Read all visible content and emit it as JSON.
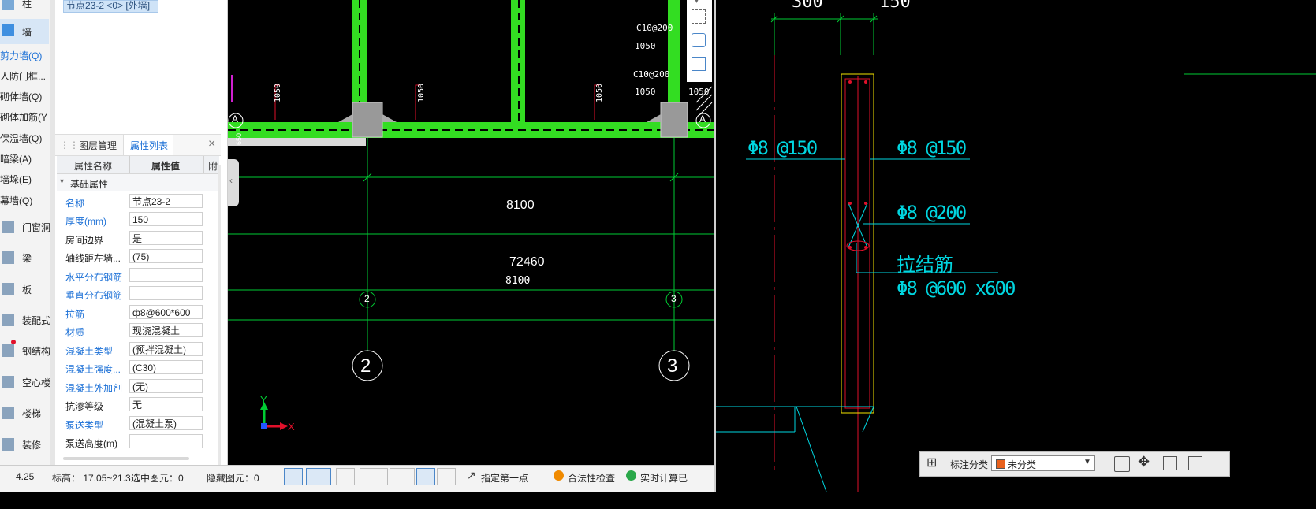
{
  "sidebar": {
    "items": [
      {
        "label": "柱",
        "icon": "column-icon"
      },
      {
        "label": "墙",
        "icon": "wall-icon"
      },
      {
        "label": "剪力墙(Q)"
      },
      {
        "label": "人防门框..."
      },
      {
        "label": "砌体墙(Q)"
      },
      {
        "label": "砌体加筋(Y"
      },
      {
        "label": "保温墙(Q)"
      },
      {
        "label": "暗梁(A)"
      },
      {
        "label": "墙垛(E)"
      },
      {
        "label": "幕墙(Q)"
      },
      {
        "label": "门窗洞",
        "icon": "door-window-icon"
      },
      {
        "label": "梁",
        "icon": "beam-icon"
      },
      {
        "label": "板",
        "icon": "slab-icon"
      },
      {
        "label": "装配式",
        "icon": "prefab-icon"
      },
      {
        "label": "钢结构",
        "icon": "steel-icon"
      },
      {
        "label": "空心楼盖",
        "icon": "hollow-floor-icon"
      },
      {
        "label": "楼梯",
        "icon": "stair-icon"
      },
      {
        "label": "装修",
        "icon": "decoration-icon"
      }
    ]
  },
  "tree": {
    "selected_item": "节点23-2 <0> [外墙]"
  },
  "panel": {
    "tabs": [
      {
        "label": "图层管理"
      },
      {
        "label": "属性列表"
      }
    ],
    "close_glyph": "×",
    "header": {
      "name_col": "属性名称",
      "value_col": "属性值",
      "extra_col": "附"
    },
    "group": "基础属性",
    "rows": [
      {
        "name": "名称",
        "value": "节点23-2",
        "style": "blue"
      },
      {
        "name": "厚度(mm)",
        "value": "150",
        "style": "blue"
      },
      {
        "name": "房间边界",
        "value": "是",
        "style": "black"
      },
      {
        "name": "轴线距左墙...",
        "value": "(75)",
        "style": "black"
      },
      {
        "name": "水平分布钢筋",
        "value": "",
        "style": "blue"
      },
      {
        "name": "垂直分布钢筋",
        "value": "",
        "style": "blue"
      },
      {
        "name": "拉筋",
        "value": "ф8@600*600",
        "style": "blue"
      },
      {
        "name": "材质",
        "value": "现浇混凝土",
        "style": "blue"
      },
      {
        "name": "混凝土类型",
        "value": "(预拌混凝土)",
        "style": "blue"
      },
      {
        "name": "混凝土强度...",
        "value": "(C30)",
        "style": "blue"
      },
      {
        "name": "混凝土外加剂",
        "value": "(无)",
        "style": "blue"
      },
      {
        "name": "抗渗等级",
        "value": "无",
        "style": "black"
      },
      {
        "name": "泵送类型",
        "value": "(混凝土泵)",
        "style": "blue"
      },
      {
        "name": "泵送高度(m)",
        "value": "",
        "style": "black"
      }
    ]
  },
  "cad_left": {
    "rebar_top1": "C10@200",
    "len_top1": "1050",
    "rebar_top2": "C10@200",
    "len_top2": "1050",
    "len_top3": "1050",
    "vert_labels": [
      "1050",
      "1050",
      "1050"
    ],
    "left_small": "650",
    "axis_a": "A",
    "dim_bay": "8100",
    "dim_total": "72460",
    "dim_bay2": "8100",
    "grid_small_2": "2",
    "grid_small_3": "3",
    "grid_big_2": "2",
    "grid_big_3": "3",
    "ucs_x": "X",
    "ucs_y": "Y"
  },
  "cad_right": {
    "dim_300": "300",
    "dim_150": "150",
    "rebar_left": "Φ8 @150",
    "rebar_right": "Φ8 @150",
    "rebar_mid": "Φ8 @200",
    "tie_label": "拉结筋",
    "tie_spec": "Φ8 @600 x600"
  },
  "status": {
    "coord": "4.25",
    "elevation": "标高：  17.05~21.3",
    "selected": "选中图元：0",
    "hidden": "隐藏图元：0",
    "specify_first": "指定第一点",
    "legality": "合法性检查",
    "realtime": "实时计算已"
  },
  "annotation": {
    "label": "标注分类",
    "selected": "未分类",
    "swatch_color": "#e8601c"
  },
  "colors": {
    "wall_green": "#33dd22",
    "grid_green": "#00cc33",
    "cyan": "#00d6e0",
    "yellow": "#f5e400",
    "red": "#e0102a"
  }
}
